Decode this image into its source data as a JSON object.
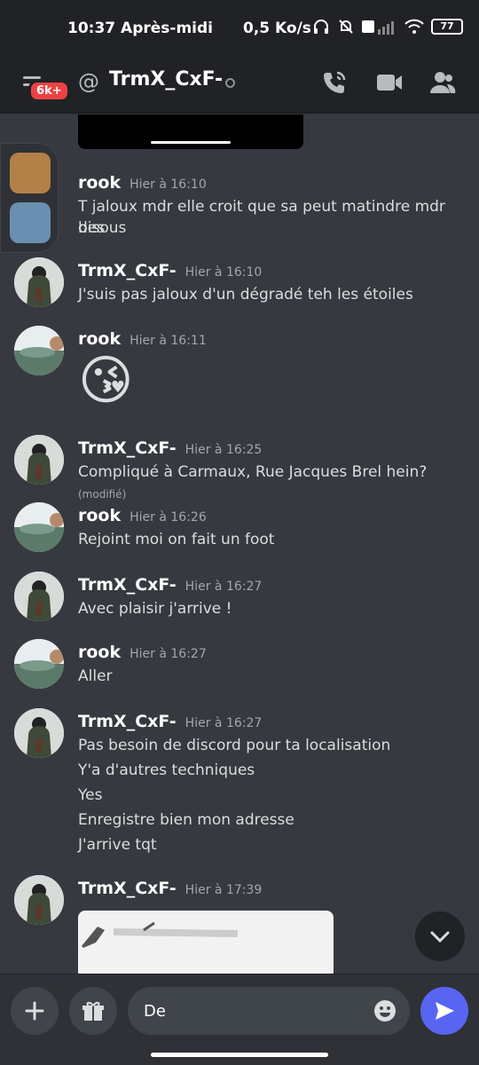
{
  "status": {
    "time": "10:37 Après-midi",
    "network": "0,5 Ko/s",
    "battery": "77"
  },
  "header": {
    "badge": "6k+",
    "title": "TrmX_CxF-"
  },
  "messages": [
    {
      "author": "rook",
      "timestamp": "Hier à 16:10",
      "lines": [
        "T jaloux mdr elle croit que sa peut matindre mdr des",
        "bisous"
      ]
    },
    {
      "author": "TrmX_CxF-",
      "timestamp": "Hier à 16:10",
      "lines": [
        "J'suis pas jaloux d'un dégradé teh les étoiles"
      ]
    },
    {
      "author": "rook",
      "timestamp": "Hier à 16:11",
      "emoji": "😘"
    },
    {
      "author": "TrmX_CxF-",
      "timestamp": "Hier à 16:25",
      "lines": [
        "Compliqué à Carmaux, Rue Jacques Brel hein?"
      ],
      "edited": "(modifié)"
    },
    {
      "author": "rook",
      "timestamp": "Hier à 16:26",
      "lines": [
        "Rejoint moi on fait un foot"
      ]
    },
    {
      "author": "TrmX_CxF-",
      "timestamp": "Hier à 16:27",
      "lines": [
        "Avec plaisir j'arrive !"
      ]
    },
    {
      "author": "rook",
      "timestamp": "Hier à 16:27",
      "lines": [
        "Aller"
      ]
    },
    {
      "author": "TrmX_CxF-",
      "timestamp": "Hier à 16:27",
      "lines": [
        "Pas besoin de discord pour ta localisation",
        "Y'a d'autres techniques",
        "Yes",
        "Enregistre bien mon adresse",
        "J'arrive tqt"
      ]
    },
    {
      "author": "TrmX_CxF-",
      "timestamp": "Hier à 17:39"
    }
  ],
  "composer": {
    "value": "De"
  },
  "colors": {
    "background": "#36393f",
    "header": "#202225",
    "accent": "#5865f2",
    "badge": "#ed4245"
  }
}
